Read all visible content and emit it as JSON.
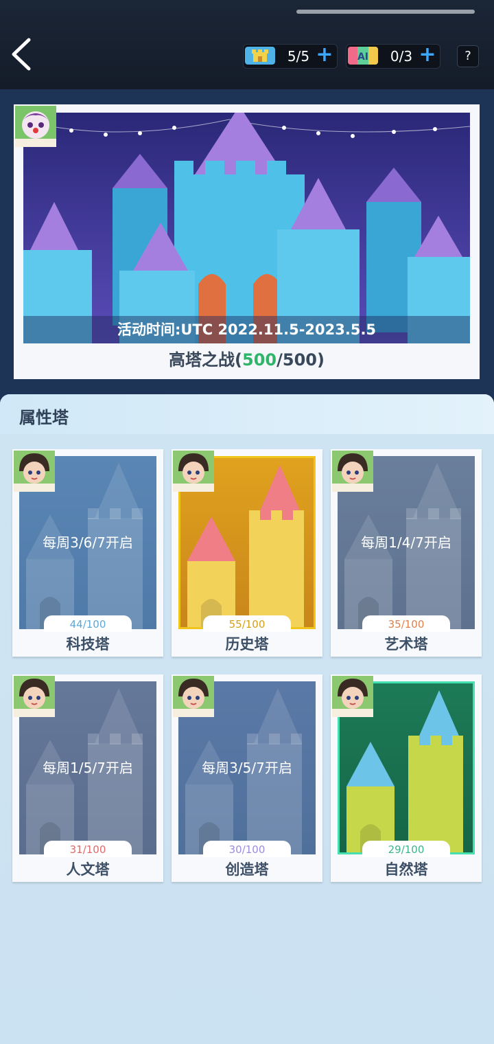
{
  "header": {
    "tickets": [
      {
        "icon": "castle-ticket-icon",
        "count": "5/5"
      },
      {
        "icon": "ai-ticket-icon",
        "count": "0/3"
      }
    ],
    "help_label": "?"
  },
  "banner": {
    "time_text": "活动时间:UTC 2022.11.5-2023.5.5",
    "title_prefix": "高塔之战(",
    "current": "500",
    "total_suffix": "/500)"
  },
  "section": {
    "title": "属性塔"
  },
  "towers": [
    {
      "name": "科技塔",
      "progress": "44/100",
      "schedule": "每周3/6/7开启",
      "locked": true,
      "progress_color": "#5aa8d8"
    },
    {
      "name": "历史塔",
      "progress": "55/100",
      "schedule": "",
      "locked": false,
      "progress_color": "#d4a017"
    },
    {
      "name": "艺术塔",
      "progress": "35/100",
      "schedule": "每周1/4/7开启",
      "locked": true,
      "progress_color": "#e0804a"
    },
    {
      "name": "人文塔",
      "progress": "31/100",
      "schedule": "每周1/5/7开启",
      "locked": true,
      "progress_color": "#e06a6a"
    },
    {
      "name": "创造塔",
      "progress": "30/100",
      "schedule": "每周3/5/7开启",
      "locked": true,
      "progress_color": "#9d8be0"
    },
    {
      "name": "自然塔",
      "progress": "29/100",
      "schedule": "",
      "locked": false,
      "progress_color": "#3cb38a"
    }
  ]
}
